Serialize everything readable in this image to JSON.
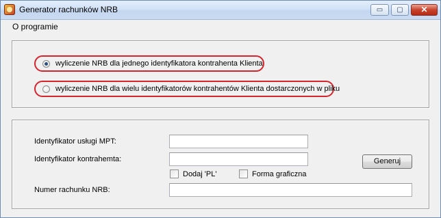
{
  "window": {
    "title": "Generator rachunków NRB",
    "controls": {
      "minimize": "▭",
      "maximize": "▢",
      "close": "✕"
    }
  },
  "menu": {
    "items": [
      {
        "label": "O programie"
      }
    ]
  },
  "mode": {
    "options": [
      {
        "label": "wyliczenie NRB dla jednego identyfikatora kontrahenta Klienta",
        "checked": true
      },
      {
        "label": "wyliczenie NRB dla wielu identyfikatorów kontrahentów Klienta dostarczonych w pliku",
        "checked": false
      }
    ]
  },
  "form": {
    "mpt_label": "Identyfikator usługi MPT:",
    "mpt_value": "",
    "contractor_label": "Identyfikator kontrahemta:",
    "contractor_value": "",
    "add_pl_label": "Dodaj 'PL'",
    "add_pl_checked": false,
    "graphic_label": "Forma graficzna",
    "graphic_checked": false,
    "nrb_label": "Numer rachunku NRB:",
    "nrb_value": "",
    "generate_label": "Generuj"
  },
  "colors": {
    "highlight": "#d6242c",
    "titlebar": "#d2e2f6",
    "background": "#f0f0f0"
  }
}
